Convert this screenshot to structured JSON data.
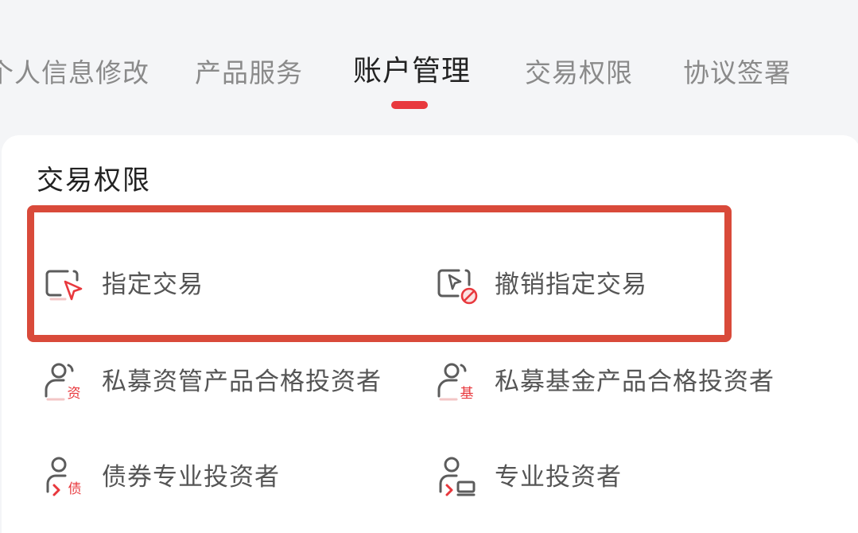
{
  "tabs": [
    {
      "label": "个人信息修改",
      "active": false
    },
    {
      "label": "产品服务",
      "active": false
    },
    {
      "label": "账户管理",
      "active": true
    },
    {
      "label": "交易权限",
      "active": false
    },
    {
      "label": "协议签署",
      "active": false
    }
  ],
  "section": {
    "title": "交易权限",
    "items": [
      {
        "label": "指定交易",
        "icon": "designated-trade-icon"
      },
      {
        "label": "撤销指定交易",
        "icon": "revoke-designated-trade-icon"
      },
      {
        "label": "私募资管产品合格投资者",
        "icon": "private-asset-investor-icon",
        "badge": "资"
      },
      {
        "label": "私募基金产品合格投资者",
        "icon": "private-fund-investor-icon",
        "badge": "基"
      },
      {
        "label": "债券专业投资者",
        "icon": "bond-investor-icon",
        "badge": "债"
      },
      {
        "label": "专业投资者",
        "icon": "professional-investor-icon"
      }
    ]
  },
  "colors": {
    "accent": "#e8383d",
    "highlight_border": "#d94a3a",
    "icon_gray": "#5c5c5c"
  }
}
